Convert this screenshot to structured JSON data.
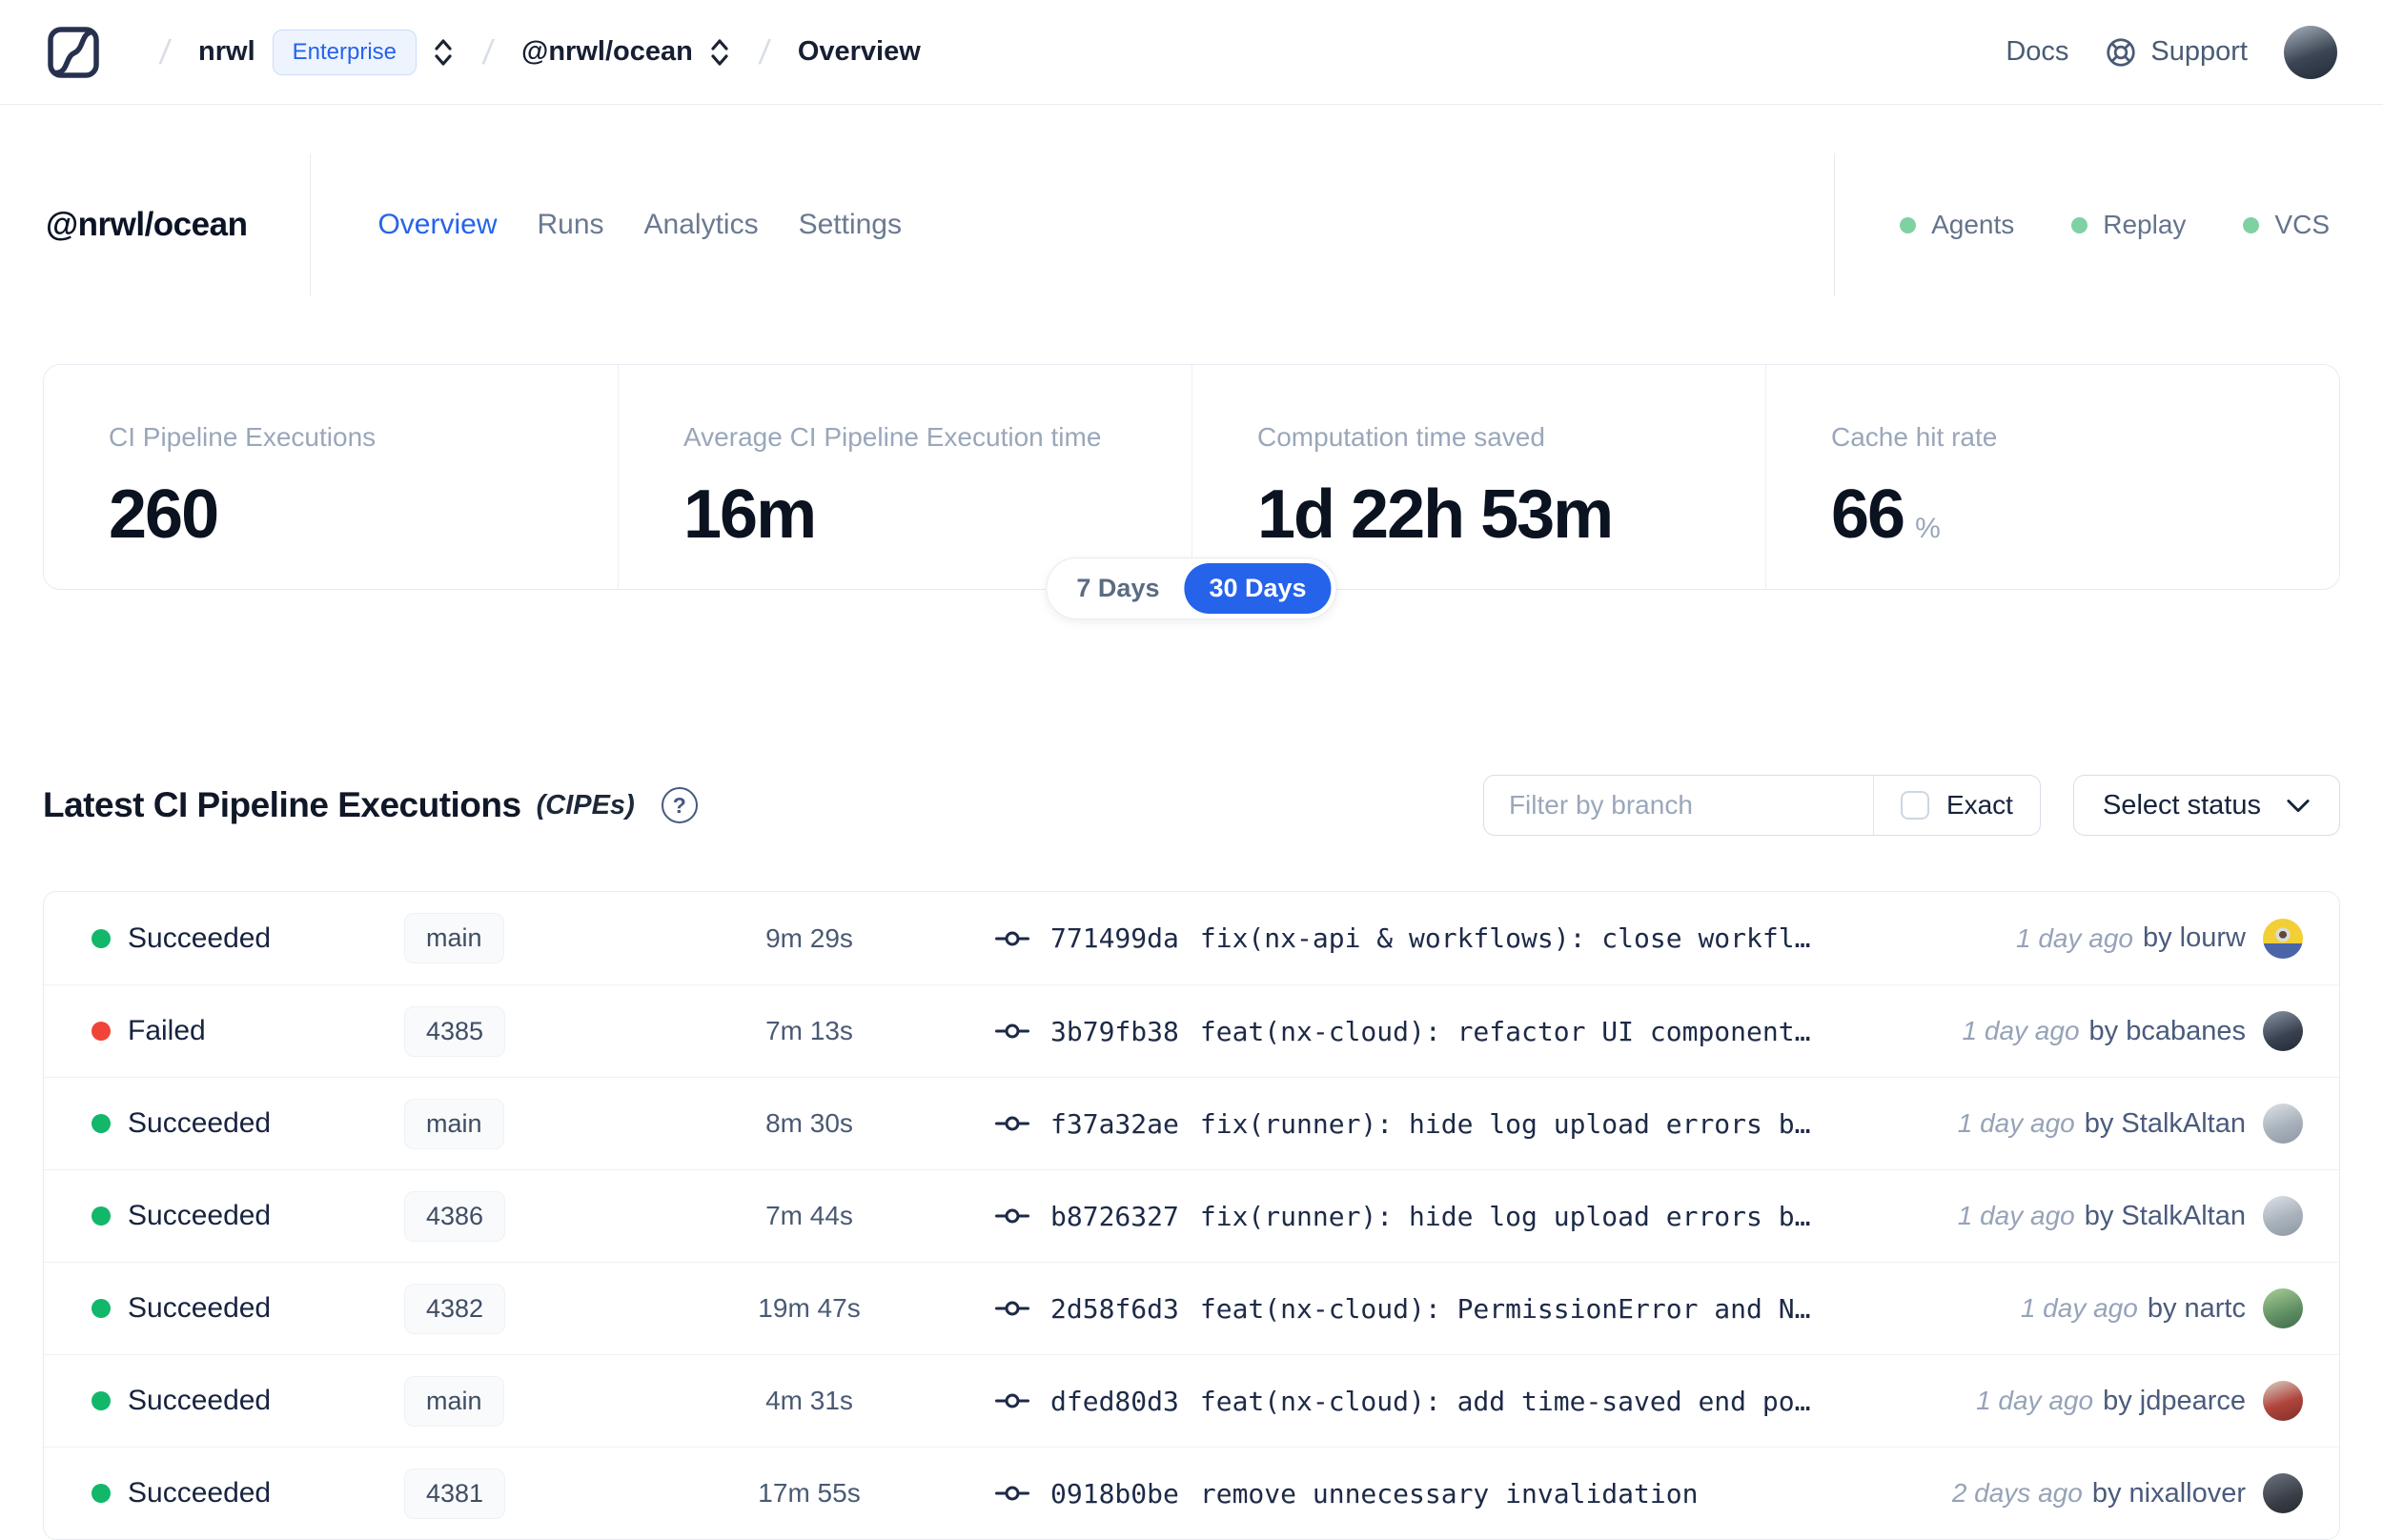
{
  "colors": {
    "accent": "#2563eb",
    "success": "#12b76a",
    "failed": "#f04438",
    "indicator-green": "#7fd1a2"
  },
  "nav": {
    "breadcrumb": {
      "org": "nrwl",
      "org_badge": "Enterprise",
      "workspace": "@nrwl/ocean",
      "page": "Overview"
    },
    "links": {
      "docs": "Docs",
      "support": "Support"
    }
  },
  "header": {
    "title": "@nrwl/ocean",
    "tabs": [
      {
        "label": "Overview"
      },
      {
        "label": "Runs"
      },
      {
        "label": "Analytics"
      },
      {
        "label": "Settings"
      }
    ],
    "statuses": [
      {
        "label": "Agents"
      },
      {
        "label": "Replay"
      },
      {
        "label": "VCS"
      }
    ]
  },
  "stats": {
    "period": {
      "options": [
        "7 Days",
        "30 Days"
      ],
      "selected": "30 Days"
    },
    "cards": [
      {
        "label": "CI Pipeline Executions",
        "value": "260",
        "unit": ""
      },
      {
        "label": "Average CI Pipeline Execution time",
        "value": "16m",
        "unit": ""
      },
      {
        "label": "Computation time saved",
        "value": "1d 22h 53m",
        "unit": ""
      },
      {
        "label": "Cache hit rate",
        "value": "66",
        "unit": "%"
      }
    ]
  },
  "cipe_section": {
    "title": "Latest CI Pipeline Executions",
    "title_suffix": "(CIPEs)",
    "filter": {
      "placeholder": "Filter by branch",
      "exact_label": "Exact",
      "status_label": "Select status"
    },
    "rows": [
      {
        "status": "Succeeded",
        "state": "success",
        "branch": "main",
        "duration": "9m 29s",
        "hash": "771499da",
        "message": "fix(nx-api & workflows): close workfl…",
        "time": "1 day ago",
        "author": "by lourw"
      },
      {
        "status": "Failed",
        "state": "failed",
        "branch": "4385",
        "duration": "7m 13s",
        "hash": "3b79fb38",
        "message": "feat(nx-cloud): refactor UI component…",
        "time": "1 day ago",
        "author": "by bcabanes"
      },
      {
        "status": "Succeeded",
        "state": "success",
        "branch": "main",
        "duration": "8m 30s",
        "hash": "f37a32ae",
        "message": "fix(runner): hide log upload errors b…",
        "time": "1 day ago",
        "author": "by StalkAltan"
      },
      {
        "status": "Succeeded",
        "state": "success",
        "branch": "4386",
        "duration": "7m 44s",
        "hash": "b8726327",
        "message": "fix(runner): hide log upload errors b…",
        "time": "1 day ago",
        "author": "by StalkAltan"
      },
      {
        "status": "Succeeded",
        "state": "success",
        "branch": "4382",
        "duration": "19m 47s",
        "hash": "2d58f6d3",
        "message": "feat(nx-cloud): PermissionError and N…",
        "time": "1 day ago",
        "author": "by nartc"
      },
      {
        "status": "Succeeded",
        "state": "success",
        "branch": "main",
        "duration": "4m 31s",
        "hash": "dfed80d3",
        "message": "feat(nx-cloud): add time-saved end po…",
        "time": "1 day ago",
        "author": "by jdpearce"
      },
      {
        "status": "Succeeded",
        "state": "success",
        "branch": "4381",
        "duration": "17m 55s",
        "hash": "0918b0be",
        "message": "remove unnecessary invalidation",
        "time": "2 days ago",
        "author": "by nixallover"
      }
    ]
  }
}
